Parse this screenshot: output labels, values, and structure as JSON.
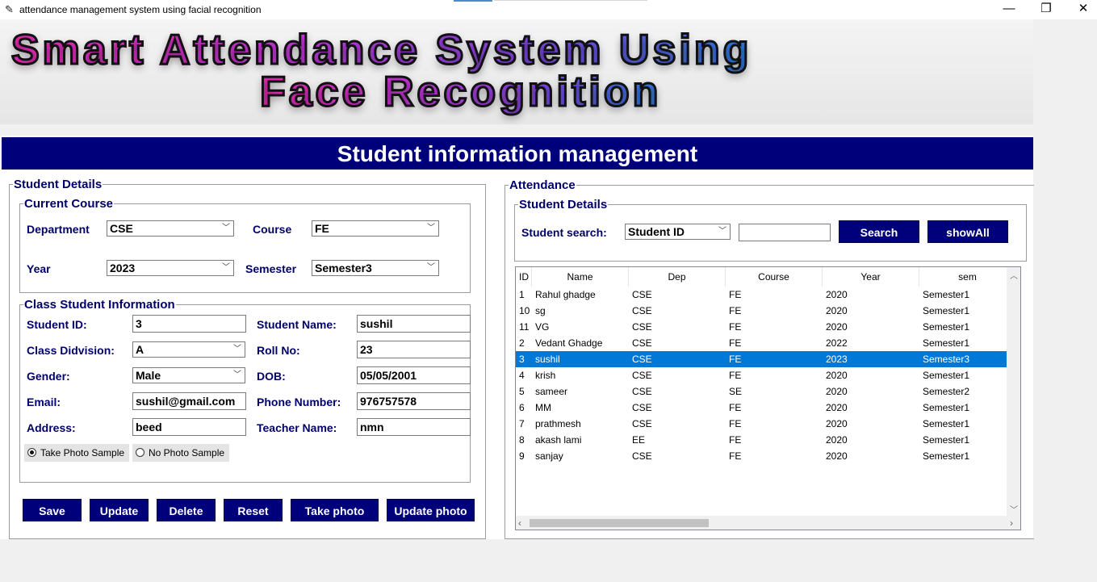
{
  "window": {
    "title": "attendance management system using facial recognition",
    "app_icon": "feather-icon",
    "minimize": "—",
    "restore": "❐",
    "close": "✕"
  },
  "banner": {
    "line1": "Smart Attendance System Using",
    "line2": "Face Recognition"
  },
  "header": {
    "title": "Student information management"
  },
  "left": {
    "frame_title": "Student Details",
    "current_course": {
      "title": "Current Course",
      "department_label": "Department",
      "department_value": "CSE",
      "course_label": "Course",
      "course_value": "FE",
      "year_label": "Year",
      "year_value": "2023",
      "semester_label": "Semester",
      "semester_value": "Semester3"
    },
    "class_info": {
      "title": "Class Student Information",
      "student_id_label": "Student ID:",
      "student_id_value": "3",
      "student_name_label": "Student Name:",
      "student_name_value": "sushil",
      "division_label": "Class Didvision:",
      "division_value": "A",
      "roll_label": "Roll No:",
      "roll_value": "23",
      "gender_label": "Gender:",
      "gender_value": "Male",
      "dob_label": "DOB:",
      "dob_value": "05/05/2001",
      "email_label": "Email:",
      "email_value": "sushil@gmail.com",
      "phone_label": "Phone Number:",
      "phone_value": "976757578",
      "address_label": "Address:",
      "address_value": "beed",
      "teacher_label": "Teacher Name:",
      "teacher_value": "nmn",
      "radio_take": "Take Photo Sample",
      "radio_no": "No Photo Sample",
      "radio_selected": "take"
    },
    "buttons": {
      "save": "Save",
      "update": "Update",
      "delete": "Delete",
      "reset": "Reset",
      "take_photo": "Take photo",
      "update_photo": "Update photo"
    }
  },
  "right": {
    "frame_title": "Attendance",
    "search_frame_title": "Student Details",
    "search_label": "Student search:",
    "search_by": "Student ID",
    "search_value": "",
    "search_button": "Search",
    "show_all_button": "showAll",
    "table": {
      "columns": [
        "ID",
        "Name",
        "Dep",
        "Course",
        "Year",
        "sem"
      ],
      "rows": [
        [
          "1",
          "Rahul ghadge",
          "CSE",
          "FE",
          "2020",
          "Semester1"
        ],
        [
          "10",
          "sg",
          "CSE",
          "FE",
          "2020",
          "Semester1"
        ],
        [
          "11",
          "VG",
          "CSE",
          "FE",
          "2020",
          "Semester1"
        ],
        [
          "2",
          "Vedant Ghadge",
          "CSE",
          "FE",
          "2022",
          "Semester1"
        ],
        [
          "3",
          "sushil",
          "CSE",
          "FE",
          "2023",
          "Semester3"
        ],
        [
          "4",
          "krish",
          "CSE",
          "FE",
          "2020",
          "Semester1"
        ],
        [
          "5",
          "sameer",
          "CSE",
          "SE",
          "2020",
          "Semester2"
        ],
        [
          "6",
          "MM",
          "CSE",
          "FE",
          "2020",
          "Semester1"
        ],
        [
          "7",
          "prathmesh",
          "CSE",
          "FE",
          "2020",
          "Semester1"
        ],
        [
          "8",
          "akash lami",
          "EE",
          "FE",
          "2020",
          "Semester1"
        ],
        [
          "9",
          "sanjay",
          "CSE",
          "FE",
          "2020",
          "Semester1"
        ]
      ],
      "selected_row": 4
    }
  },
  "colors": {
    "accent": "#00007a",
    "label": "#00006a",
    "selection": "#0078d7"
  }
}
